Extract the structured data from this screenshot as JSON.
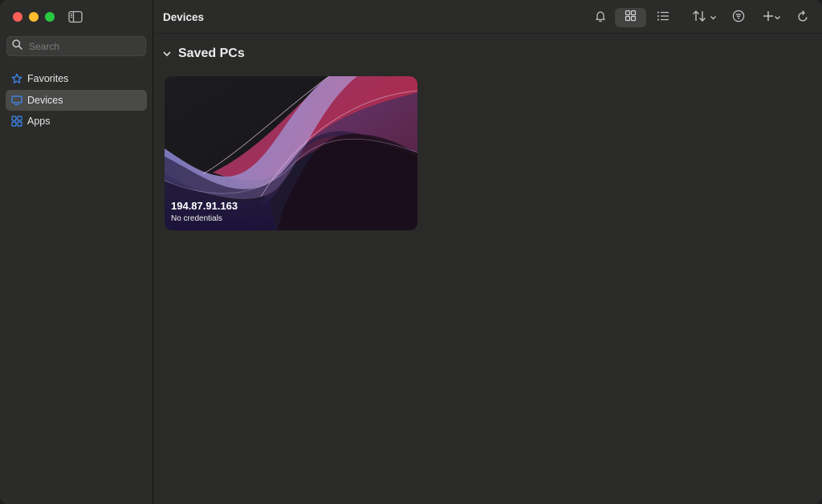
{
  "window": {
    "title": "Devices"
  },
  "sidebar": {
    "search": {
      "placeholder": "Search",
      "value": ""
    },
    "items": [
      {
        "label": "Favorites",
        "icon": "star-icon",
        "active": false
      },
      {
        "label": "Devices",
        "icon": "monitor-icon",
        "active": true
      },
      {
        "label": "Apps",
        "icon": "apps-grid-icon",
        "active": false
      }
    ]
  },
  "toolbar": {
    "title": "Devices",
    "buttons": [
      "bell-icon",
      "grid-view-icon",
      "list-view-icon",
      "sort-icon",
      "filter-icon",
      "add-icon",
      "refresh-icon"
    ],
    "selected_view": "grid"
  },
  "content": {
    "section_title": "Saved PCs",
    "cards": [
      {
        "title": "194.87.91.163",
        "subtitle": "No credentials"
      }
    ]
  },
  "colors": {
    "accent": "#3d8ef7",
    "background": "#2a2a29",
    "sidebar_active": "#4a4a49"
  }
}
